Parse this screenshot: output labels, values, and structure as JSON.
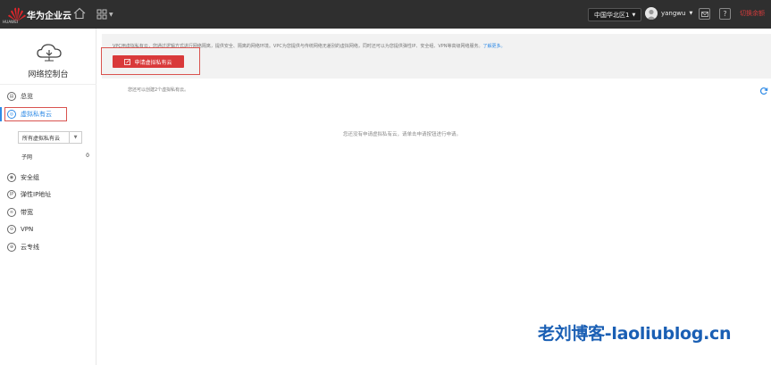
{
  "topbar": {
    "logo_text": "HUAWEI",
    "brand": "华为企业云",
    "region": "中国华北区1",
    "username": "yangwu",
    "red_link": "切换余额"
  },
  "sidebar": {
    "title": "网络控制台",
    "items": [
      {
        "label": "总览"
      },
      {
        "label": "虚拟私有云"
      },
      {
        "label": "安全组"
      },
      {
        "label": "弹性IP地址"
      },
      {
        "label": "带宽"
      },
      {
        "label": "VPN"
      },
      {
        "label": "云专线"
      }
    ],
    "vpc_filter": "所有虚拟私有云",
    "subnet_label": "子网",
    "subnet_count": "0"
  },
  "main": {
    "intro_text": "VPC用虚拟私有云，您通过逻辑方式进行网络隔离，提供安全、隔离的网络环境。VPC为您提供与传统网络无差别的虚拟网络，同时还可以为您提供弹性IP、安全组、VPN等高级网络服务。",
    "learn_more": "了解更多。",
    "apply_button": "申请虚拟私有云",
    "quota_text": "您还可以创建2个虚拟私有云。",
    "empty_text": "您还没有申请虚拟私有云，请单击申请按钮进行申请。"
  },
  "watermark": "老刘博客-laoliublog.cn",
  "colors": {
    "topbar_bg": "#2f2f2f",
    "accent_red": "#d9393a",
    "accent_blue": "#2e8ae6"
  }
}
